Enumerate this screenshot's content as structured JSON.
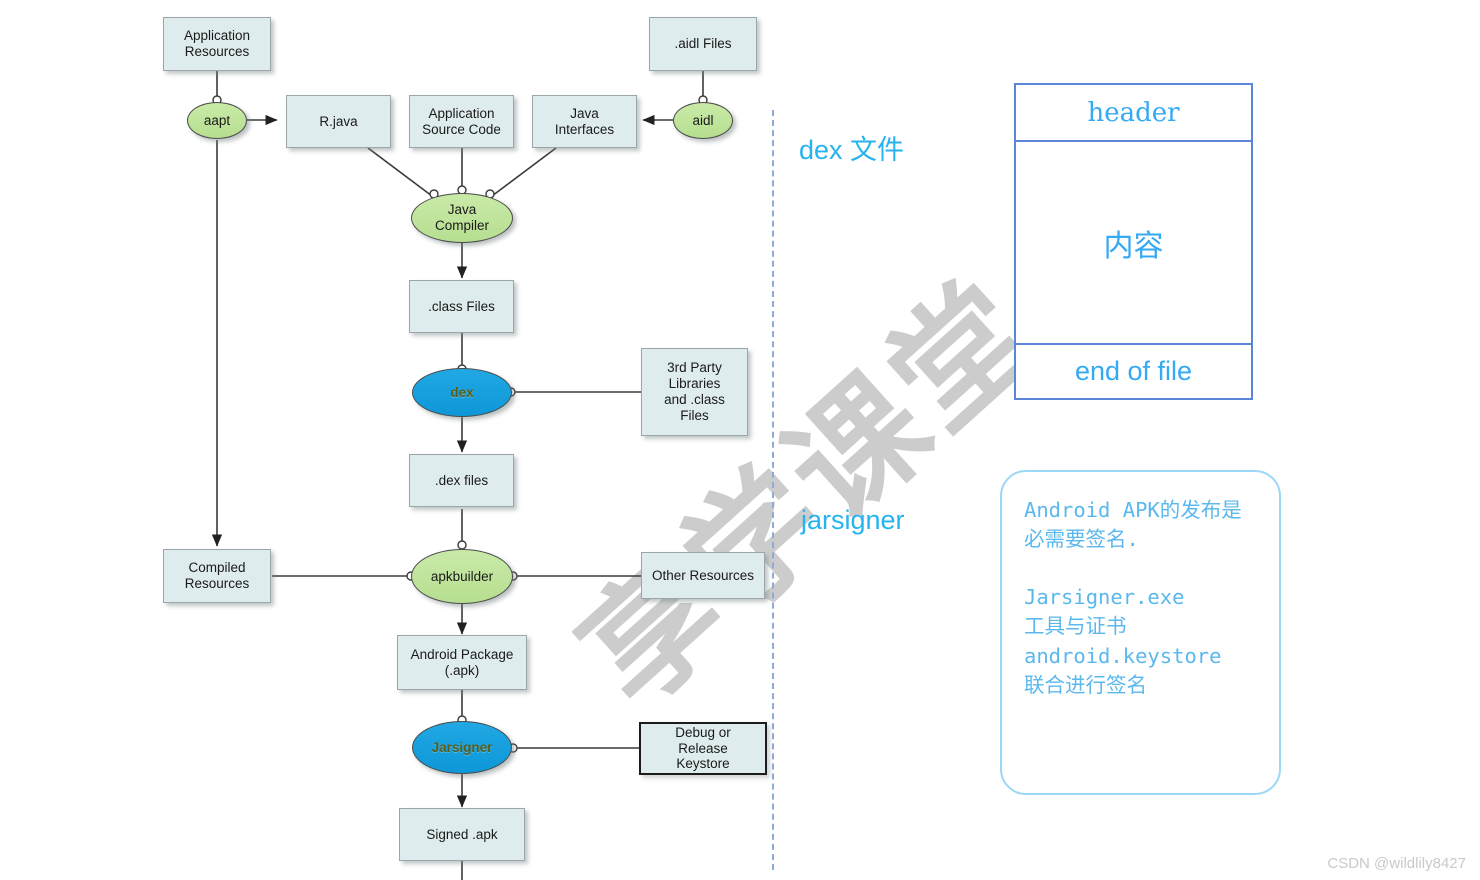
{
  "watermark": {
    "text": "享学课堂"
  },
  "credit": {
    "text": "CSDN @wildlily8427"
  },
  "annotations": [
    {
      "id": "dex-label",
      "text": "dex 文件"
    },
    {
      "id": "jarsigner-label",
      "text": "jarsigner"
    }
  ],
  "flowchart": {
    "nodes": [
      {
        "id": "application-resources",
        "label": "Application\nResources",
        "shape": "box"
      },
      {
        "id": "aidl-files",
        "label": ".aidl Files",
        "shape": "box"
      },
      {
        "id": "aapt",
        "label": "aapt",
        "shape": "ellipse",
        "fill": "green"
      },
      {
        "id": "r-java",
        "label": "R.java",
        "shape": "box"
      },
      {
        "id": "application-source-code",
        "label": "Application\nSource Code",
        "shape": "box"
      },
      {
        "id": "java-interfaces",
        "label": "Java\nInterfaces",
        "shape": "box"
      },
      {
        "id": "aidl",
        "label": "aidl",
        "shape": "ellipse",
        "fill": "green"
      },
      {
        "id": "java-compiler",
        "label": "Java\nCompiler",
        "shape": "ellipse",
        "fill": "green"
      },
      {
        "id": "class-files",
        "label": ".class Files",
        "shape": "box"
      },
      {
        "id": "dex",
        "label": "dex",
        "shape": "ellipse",
        "fill": "blue"
      },
      {
        "id": "third-party-libraries",
        "label": "3rd Party\nLibraries\nand .class\nFiles",
        "shape": "box"
      },
      {
        "id": "dex-files",
        "label": ".dex files",
        "shape": "box"
      },
      {
        "id": "compiled-resources",
        "label": "Compiled\nResources",
        "shape": "box"
      },
      {
        "id": "apkbuilder",
        "label": "apkbuilder",
        "shape": "ellipse",
        "fill": "green"
      },
      {
        "id": "other-resources",
        "label": "Other Resources",
        "shape": "box"
      },
      {
        "id": "android-package",
        "label": "Android Package\n(.apk)",
        "shape": "box"
      },
      {
        "id": "jarsigner",
        "label": "Jarsigner",
        "shape": "ellipse",
        "fill": "blue"
      },
      {
        "id": "debug-release-keystore",
        "label": "Debug or\nRelease\nKeystore",
        "shape": "box",
        "border": "dark"
      },
      {
        "id": "signed-apk",
        "label": "Signed .apk",
        "shape": "box"
      }
    ]
  },
  "dex_structure": {
    "rows": [
      {
        "id": "header",
        "label": "header"
      },
      {
        "id": "content",
        "label": "内容"
      },
      {
        "id": "end-of-file",
        "label": "end of file"
      }
    ]
  },
  "callout": {
    "text": "Android APK的发布是必需要签名.\n\nJarsigner.exe\n工具与证书\nandroid.keystore\n联合进行签名"
  },
  "colors": {
    "box_fill": "#dfeced",
    "box_border": "#9aa6a8",
    "ellipse_green": "#bfe49b",
    "ellipse_blue": "#14a0e0",
    "annotation": "#26b3f0",
    "panel_border": "#5b86d8",
    "callout_border": "#9ed7f5",
    "divider": "#8fa9d8",
    "watermark": "#c8c8c8"
  }
}
